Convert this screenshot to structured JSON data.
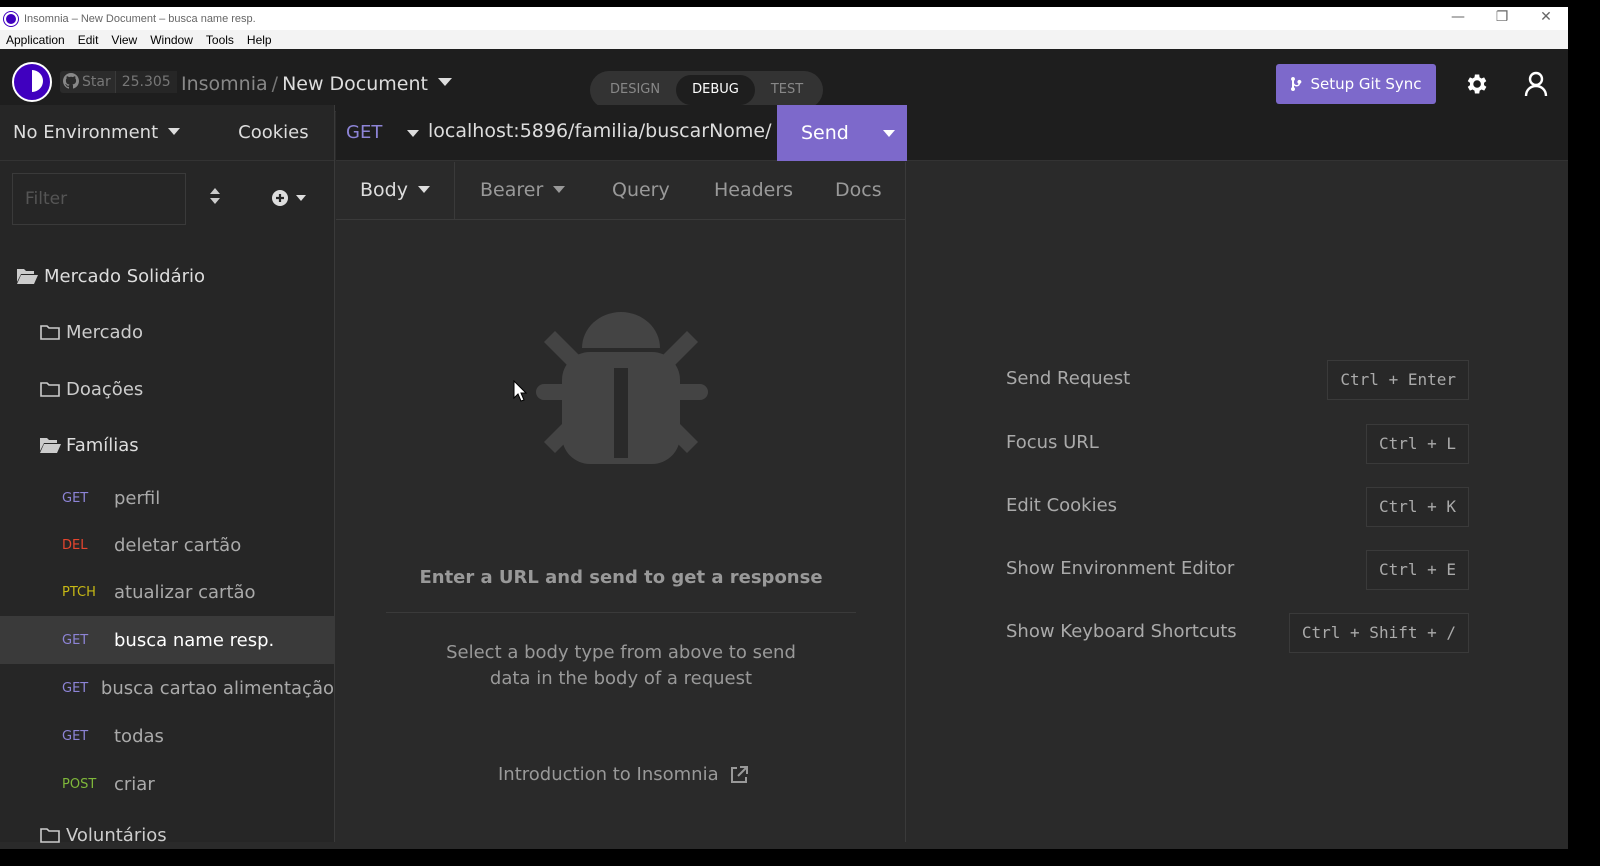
{
  "window": {
    "title": "Insomnia – New Document – busca name resp.",
    "controls": [
      "—",
      "❐",
      "✕"
    ]
  },
  "menu": [
    "Application",
    "Edit",
    "View",
    "Window",
    "Tools",
    "Help"
  ],
  "header": {
    "github_star": "Star",
    "github_count": "25.305",
    "breadcrumb_root": "Insomnia",
    "breadcrumb_sep": "/",
    "document": "New Document",
    "modes": [
      "DESIGN",
      "DEBUG",
      "TEST"
    ],
    "active_mode": "DEBUG",
    "git_sync": "Setup Git Sync",
    "accent_color": "#7d69cb"
  },
  "sidebar": {
    "environment": "No Environment",
    "cookies": "Cookies",
    "filter_placeholder": "Filter",
    "workspace": "Mercado Solidário",
    "folders": [
      "Mercado",
      "Doações",
      "Famílias",
      "Voluntários"
    ],
    "requests": [
      {
        "method": "GET",
        "name": "perfil"
      },
      {
        "method": "DEL",
        "name": "deletar cartão"
      },
      {
        "method": "PTCH",
        "name": "atualizar cartão"
      },
      {
        "method": "GET",
        "name": "busca name resp."
      },
      {
        "method": "GET",
        "name": "busca cartao alimentação"
      },
      {
        "method": "GET",
        "name": "todas"
      },
      {
        "method": "POST",
        "name": "criar"
      }
    ],
    "active_request": "busca name resp."
  },
  "request": {
    "method": "GET",
    "url": "localhost:5896/familia/buscarNome/",
    "send": "Send",
    "tabs": [
      "Body",
      "Bearer",
      "Query",
      "Headers",
      "Docs"
    ],
    "empty_title": "Enter a URL and send to get a response",
    "empty_sub": "Select a body type from above to send data in the body of a request",
    "intro_link": "Introduction to Insomnia"
  },
  "shortcuts": [
    {
      "label": "Send Request",
      "keys": "Ctrl + Enter"
    },
    {
      "label": "Focus URL",
      "keys": "Ctrl + L"
    },
    {
      "label": "Edit Cookies",
      "keys": "Ctrl + K"
    },
    {
      "label": "Show Environment Editor",
      "keys": "Ctrl + E"
    },
    {
      "label": "Show Keyboard Shortcuts",
      "keys": "Ctrl + Shift + /"
    }
  ]
}
